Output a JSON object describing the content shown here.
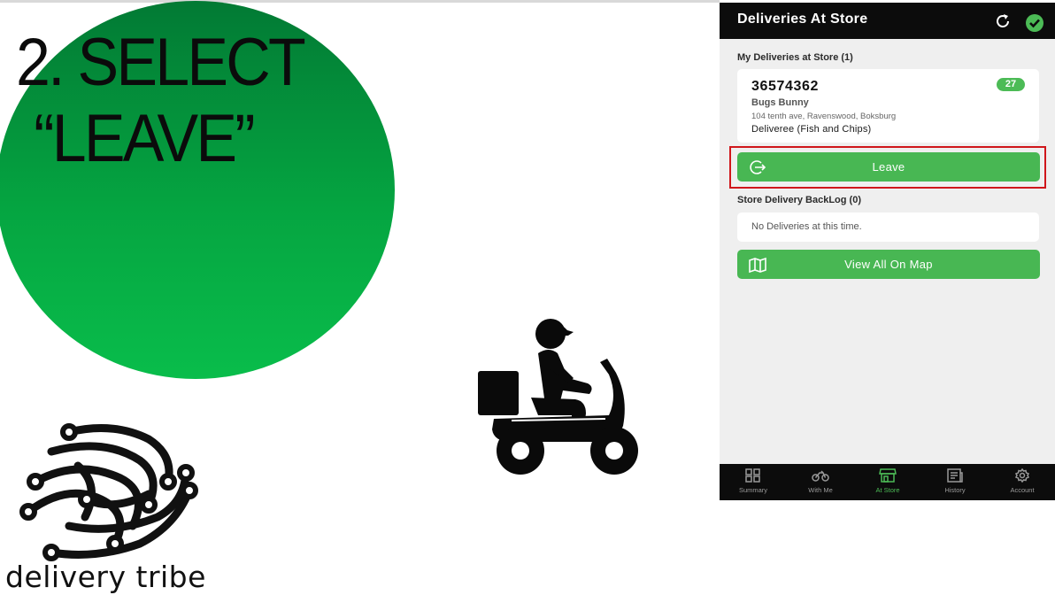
{
  "slide": {
    "step_line1": "2. SELECT",
    "step_line2": "“LEAVE”",
    "brand_name": "delivery tribe",
    "accent_color": "#06a843",
    "highlight_color": "#d0161b"
  },
  "app": {
    "title": "Deliveries At Store",
    "header_icons": [
      "refresh-icon",
      "check-circle-icon"
    ],
    "my_deliveries_title": "My Deliveries at Store (1)",
    "delivery": {
      "order_number": "36574362",
      "badge": "27",
      "customer_name": "Bugs Bunny",
      "address": "104 tenth ave, Ravenswood, Boksburg",
      "restaurant": "Deliveree (Fish and Chips)"
    },
    "leave_label": "Leave",
    "backlog_title": "Store Delivery BackLog (0)",
    "backlog_empty": "No Deliveries at this time.",
    "map_label": "View All On Map",
    "button_color": "#48b753"
  },
  "nav": {
    "items": [
      {
        "label": "Summary",
        "icon": "grid-icon"
      },
      {
        "label": "With Me",
        "icon": "motorbike-icon"
      },
      {
        "label": "At Store",
        "icon": "store-icon"
      },
      {
        "label": "History",
        "icon": "receipt-icon"
      },
      {
        "label": "Account",
        "icon": "gear-icon"
      }
    ],
    "active": "At Store",
    "active_color": "#4cbb56"
  }
}
